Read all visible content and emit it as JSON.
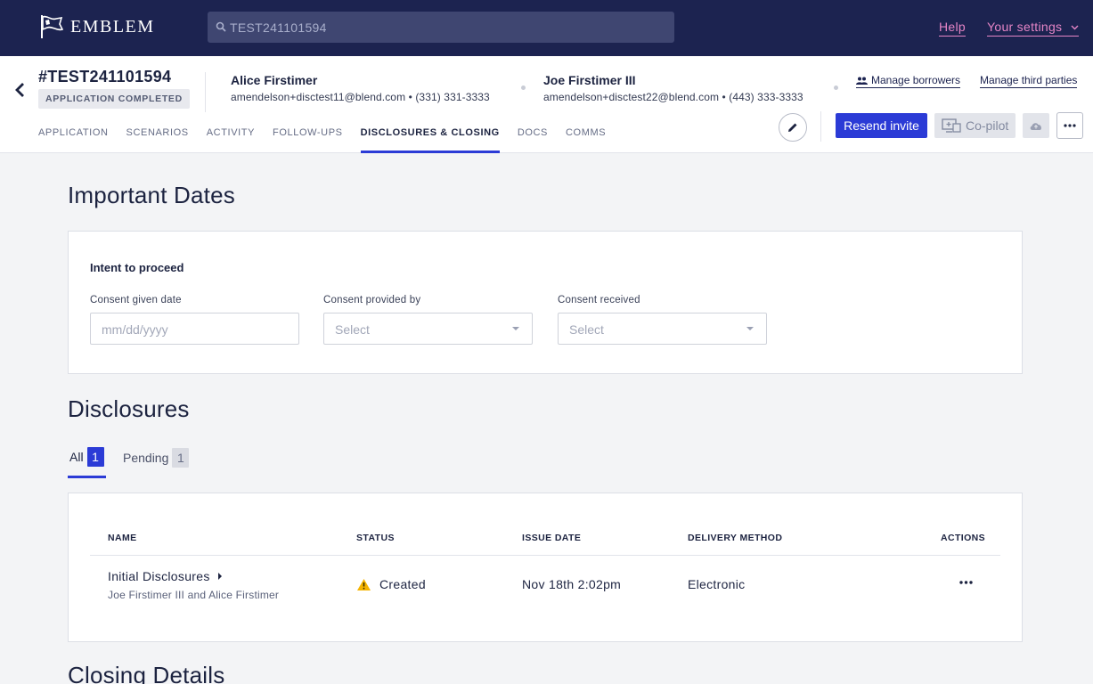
{
  "topbar": {
    "brand": "Emblem",
    "search_value": "TEST241101594",
    "help_label": "Help",
    "settings_label": "Your settings"
  },
  "application": {
    "id": "#TEST241101594",
    "status_badge": "APPLICATION COMPLETED"
  },
  "borrowers": [
    {
      "name": "Alice Firstimer",
      "contact": "amendelson+disctest11@blend.com • (331) 331-3333"
    },
    {
      "name": "Joe Firstimer III",
      "contact": "amendelson+disctest22@blend.com • (443) 333-3333"
    }
  ],
  "header_links": {
    "manage_borrowers": "Manage borrowers",
    "manage_third_parties": "Manage third parties"
  },
  "tabs": [
    {
      "label": "APPLICATION"
    },
    {
      "label": "SCENARIOS"
    },
    {
      "label": "ACTIVITY"
    },
    {
      "label": "FOLLOW-UPS"
    },
    {
      "label": "DISCLOSURES & CLOSING"
    },
    {
      "label": "DOCS"
    },
    {
      "label": "COMMS"
    }
  ],
  "actions": {
    "resend_invite": "Resend invite",
    "copilot": "Co-pilot"
  },
  "important_dates": {
    "heading": "Important Dates",
    "intent_title": "Intent to proceed",
    "consent_given_date": {
      "label": "Consent given date",
      "placeholder": "mm/dd/yyyy"
    },
    "consent_provided_by": {
      "label": "Consent provided by",
      "value": "Select"
    },
    "consent_received": {
      "label": "Consent received",
      "value": "Select"
    }
  },
  "disclosures": {
    "heading": "Disclosures",
    "tab_all": {
      "label": "All",
      "count": "1"
    },
    "tab_pending": {
      "label": "Pending",
      "count": "1"
    },
    "columns": {
      "name": "NAME",
      "status": "STATUS",
      "issue_date": "ISSUE DATE",
      "delivery_method": "DELIVERY METHOD",
      "actions": "ACTIONS"
    },
    "rows": [
      {
        "name": "Initial Disclosures",
        "borrowers": "Joe Firstimer III and Alice Firstimer",
        "status": "Created",
        "issue_date": "Nov 18th 2:02pm",
        "delivery_method": "Electronic"
      }
    ]
  },
  "closing_details": {
    "heading": "Closing Details"
  },
  "colors": {
    "navy": "#1c2350",
    "accent_blue": "#2b3bd6",
    "pink_link": "#e585c6",
    "warning": "#f5b400"
  }
}
